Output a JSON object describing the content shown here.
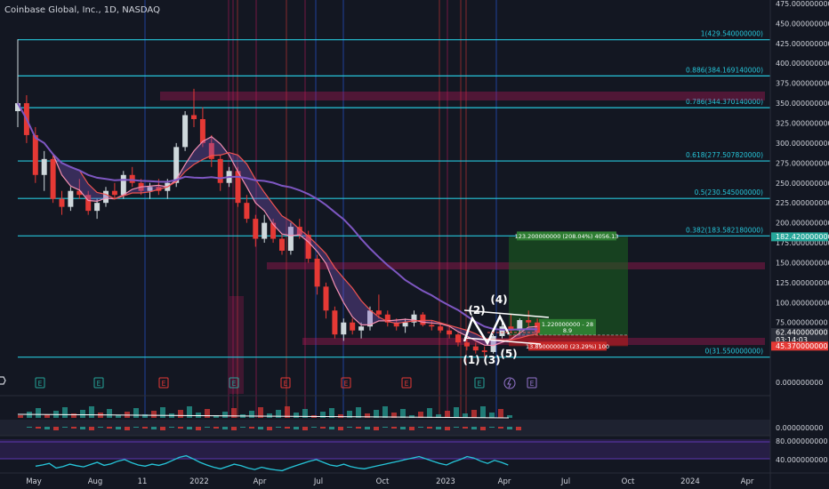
{
  "header": {
    "symbol_title": "Coinbase Global, Inc., 1D, NASDAQ"
  },
  "colors": {
    "background": "#131722",
    "fib": "#26c6da",
    "red_zone": "#c2185b",
    "up_candle": "#cfd8dc",
    "down_candle": "#e53935",
    "purple_ma": "#7e57c2",
    "red_ma": "#ef5350",
    "pink_ma": "#f48fb1",
    "profit_zone": "#1b5e20",
    "loss_zone": "#b71c1c",
    "rsi_line": "#26c6da",
    "rsi_band": "#5e35b1",
    "elliott_white": "#ffffff"
  },
  "chart_data": [
    {
      "type": "candlestick",
      "title": "Coinbase Global, Inc., 1D, NASDAQ",
      "x_axis_labels": [
        "May",
        "Aug",
        "11",
        "2022",
        "Apr",
        "Jul",
        "Oct",
        "2023",
        "Apr",
        "Jul",
        "Oct",
        "2024",
        "Apr"
      ],
      "y_axis_ticks": [
        "475.000000000",
        "450.000000000",
        "425.000000000",
        "400.000000000",
        "375.000000000",
        "350.000000000",
        "325.000000000",
        "300.000000000",
        "275.000000000",
        "250.000000000",
        "225.000000000",
        "200.000000000",
        "175.000000000",
        "150.000000000",
        "125.000000000",
        "100.000000000",
        "75.000000000",
        "59.220000000",
        "0.000000000"
      ],
      "ylim": [
        0,
        475
      ],
      "fib_levels": [
        {
          "label": "1(429.540000000)",
          "value": 429.54
        },
        {
          "label": "0.886(384.169140000)",
          "value": 384.16914
        },
        {
          "label": "0.786(344.370140000)",
          "value": 344.37014
        },
        {
          "label": "0.618(277.507820000)",
          "value": 277.50782
        },
        {
          "label": "0.5(230.545000000)",
          "value": 230.545
        },
        {
          "label": "0.382(183.582180000)",
          "value": 183.58218
        },
        {
          "label": "0(31.550000000)",
          "value": 31.55
        }
      ],
      "price_badges": [
        {
          "label": "182.420000000",
          "value": 182.42,
          "color": "#26a69a"
        },
        {
          "label": "62.440000000",
          "value": 62.44,
          "sub": "03:14:03",
          "color": "#2a2e39"
        },
        {
          "label": "45.370000000",
          "value": 45.37,
          "color": "#e53935"
        }
      ],
      "position_tool": {
        "target_label": "123.200000000 (208.04%) 4056.13",
        "entry_label": "1.220000000 - 28",
        "entry_sub": "8.9",
        "stop_label": "13.890000000 (23.29%) 100",
        "entry_value": 59.22,
        "target_value": 182.42,
        "stop_value": 45.37
      },
      "elliott_labels": [
        "(1)",
        "(2)",
        "(3)",
        "(4)",
        "(5)"
      ],
      "earnings_markers": [
        "E",
        "E",
        "E",
        "E",
        "E",
        "E",
        "E",
        "E",
        "E"
      ],
      "series": [
        {
          "values": [
            [
              0,
              340,
              430,
              320,
              350
            ],
            [
              1,
              350,
              360,
              300,
              310
            ],
            [
              2,
              310,
              320,
              250,
              260
            ],
            [
              3,
              260,
              290,
              240,
              280
            ],
            [
              4,
              280,
              285,
              225,
              230
            ],
            [
              5,
              230,
              240,
              210,
              220
            ],
            [
              6,
              220,
              245,
              215,
              240
            ],
            [
              7,
              240,
              255,
              230,
              235
            ],
            [
              8,
              235,
              240,
              210,
              215
            ],
            [
              9,
              215,
              230,
              205,
              225
            ],
            [
              10,
              225,
              245,
              220,
              240
            ],
            [
              11,
              240,
              250,
              230,
              235
            ],
            [
              12,
              235,
              265,
              230,
              260
            ],
            [
              13,
              260,
              270,
              245,
              250
            ],
            [
              14,
              250,
              255,
              235,
              240
            ],
            [
              15,
              240,
              250,
              230,
              245
            ],
            [
              16,
              245,
              255,
              235,
              240
            ],
            [
              17,
              240,
              255,
              230,
              250
            ],
            [
              18,
              250,
              300,
              245,
              295
            ],
            [
              19,
              295,
              340,
              290,
              335
            ],
            [
              20,
              335,
              368,
              320,
              330
            ],
            [
              21,
              330,
              345,
              295,
              300
            ],
            [
              22,
              300,
              310,
              270,
              280
            ],
            [
              23,
              280,
              285,
              240,
              250
            ],
            [
              24,
              250,
              270,
              245,
              265
            ],
            [
              25,
              265,
              270,
              220,
              225
            ],
            [
              26,
              225,
              235,
              200,
              205
            ],
            [
              27,
              205,
              210,
              170,
              180
            ],
            [
              28,
              180,
              210,
              175,
              200
            ],
            [
              29,
              200,
              205,
              175,
              180
            ],
            [
              30,
              180,
              185,
              160,
              165
            ],
            [
              31,
              165,
              200,
              160,
              195
            ],
            [
              32,
              195,
              205,
              180,
              185
            ],
            [
              33,
              185,
              190,
              150,
              155
            ],
            [
              34,
              155,
              160,
              110,
              120
            ],
            [
              35,
              120,
              125,
              80,
              90
            ],
            [
              36,
              90,
              95,
              55,
              60
            ],
            [
              37,
              60,
              80,
              52,
              75
            ],
            [
              38,
              75,
              80,
              60,
              65
            ],
            [
              39,
              65,
              75,
              55,
              70
            ],
            [
              40,
              70,
              95,
              65,
              90
            ],
            [
              41,
              90,
              110,
              80,
              85
            ],
            [
              42,
              85,
              90,
              70,
              75
            ],
            [
              43,
              75,
              80,
              65,
              70
            ],
            [
              44,
              70,
              80,
              62,
              75
            ],
            [
              45,
              75,
              90,
              70,
              85
            ],
            [
              46,
              85,
              88,
              70,
              72
            ],
            [
              47,
              72,
              78,
              65,
              70
            ],
            [
              48,
              70,
              75,
              62,
              65
            ],
            [
              49,
              65,
              72,
              55,
              60
            ],
            [
              50,
              60,
              62,
              45,
              50
            ],
            [
              51,
              50,
              55,
              40,
              45
            ],
            [
              52,
              45,
              50,
              36,
              40
            ],
            [
              53,
              40,
              45,
              32,
              38
            ],
            [
              54,
              38,
              60,
              36,
              58
            ],
            [
              55,
              58,
              75,
              55,
              70
            ],
            [
              56,
              70,
              85,
              62,
              65
            ],
            [
              57,
              65,
              80,
              60,
              78
            ],
            [
              58,
              78,
              90,
              70,
              75
            ],
            [
              59,
              75,
              80,
              58,
              62
            ]
          ]
        }
      ]
    },
    {
      "type": "bar",
      "title": "",
      "y_axis_ticks": [
        "0.000000000"
      ]
    },
    {
      "type": "line",
      "title": "",
      "y_axis_ticks": [
        "80.000000000",
        "40.000000000"
      ],
      "ylim": [
        20,
        90
      ],
      "series": [
        {
          "values": [
            45,
            48,
            52,
            40,
            44,
            50,
            46,
            43,
            49,
            55,
            47,
            51,
            58,
            62,
            54,
            48,
            45,
            50,
            47,
            52,
            60,
            68,
            72,
            64,
            55,
            48,
            42,
            38,
            44,
            50,
            46,
            40,
            36,
            42,
            38,
            35,
            33,
            40,
            46,
            52,
            58,
            62,
            55,
            48,
            45,
            50,
            44,
            40,
            38,
            42,
            46,
            50,
            54,
            58,
            62,
            66,
            70,
            64,
            58,
            52,
            48,
            56,
            62,
            70,
            66,
            58,
            52,
            60,
            55,
            48
          ]
        }
      ]
    }
  ]
}
